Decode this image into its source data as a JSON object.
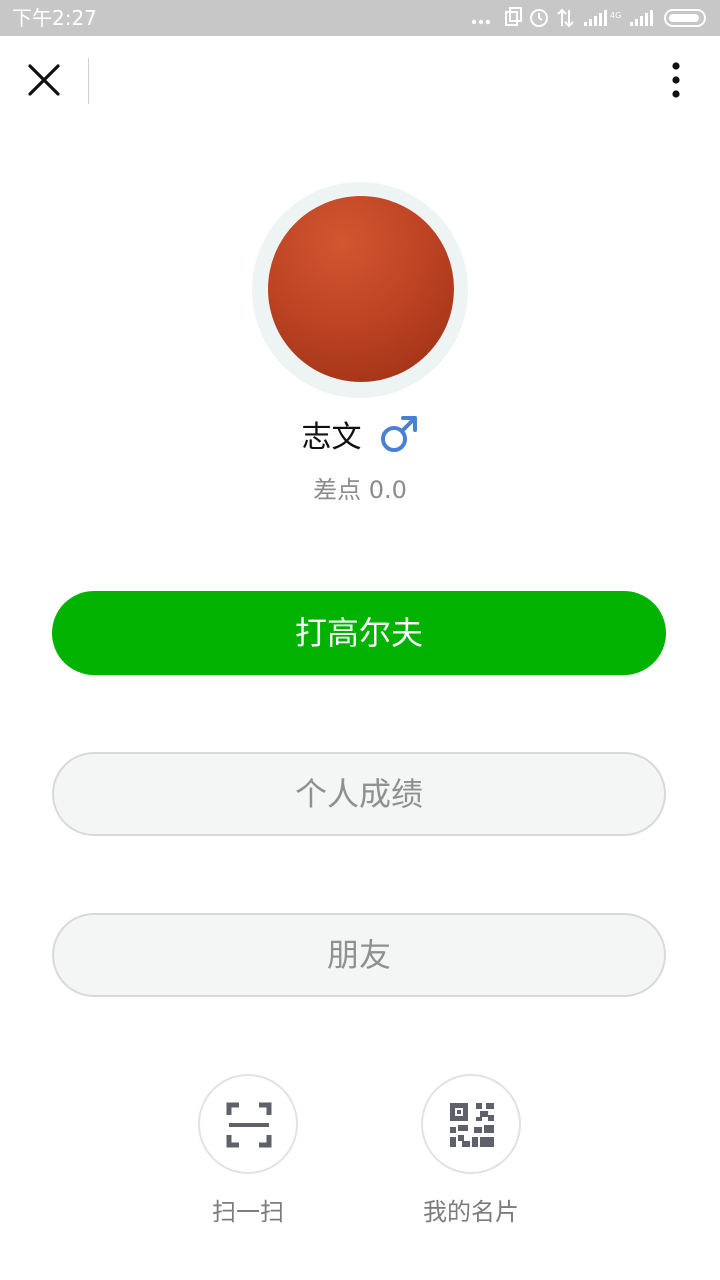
{
  "status_bar": {
    "time": "下午2:27"
  },
  "navbar": {
    "close_icon": "close-icon",
    "more_icon": "more-vertical-icon"
  },
  "profile": {
    "name": "志文",
    "gender_icon": "male-icon",
    "handicap": "差点 0.0",
    "avatar_color": "#be4424"
  },
  "actions": {
    "play_golf": "打高尔夫",
    "personal_stats": "个人成绩",
    "friends": "朋友"
  },
  "quick_actions": [
    {
      "label": "扫一扫",
      "icon": "scan-icon"
    },
    {
      "label": "我的名片",
      "icon": "qr-code-icon"
    }
  ],
  "colors": {
    "primary": "#01b300",
    "gender_blue": "#4a7fd6",
    "status_bar_bg": "#c7c7c7"
  }
}
